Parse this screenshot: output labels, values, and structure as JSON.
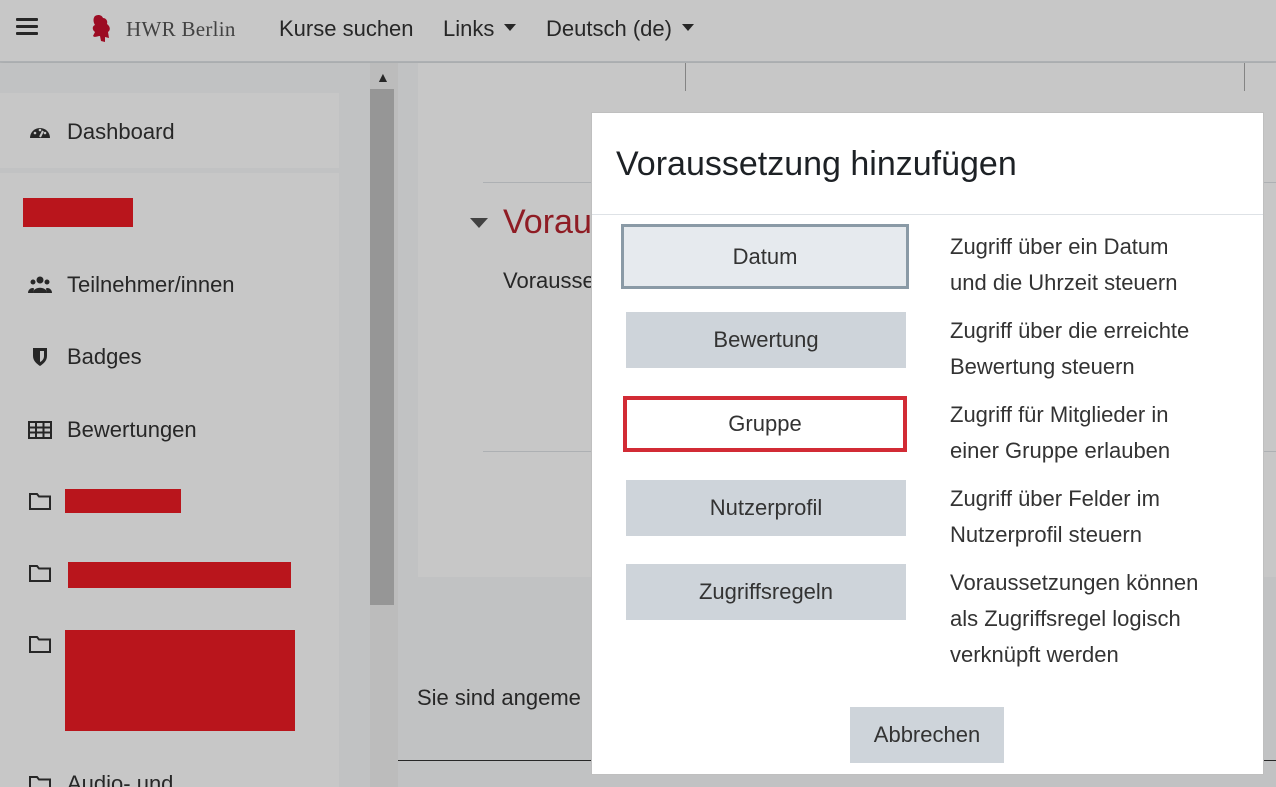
{
  "navbar": {
    "brand": "HWR Berlin",
    "links": [
      {
        "label": "Kurse suchen"
      },
      {
        "label": "Links"
      },
      {
        "label": "Deutsch (de)"
      }
    ]
  },
  "drawer": {
    "items": [
      {
        "label": "Dashboard",
        "icon": "dashboard-icon"
      },
      {
        "label": "Teilnehmer/innen",
        "icon": "users-icon"
      },
      {
        "label": "Badges",
        "icon": "shield-icon"
      },
      {
        "label": "Bewertungen",
        "icon": "table-icon"
      },
      {
        "label": "Audio- und",
        "icon": "folder-icon"
      }
    ]
  },
  "main": {
    "section_title": "Voraus",
    "section_subtitle": "Voraussetz",
    "footer_text": "Sie sind angeme"
  },
  "modal": {
    "title": "Voraussetzung hinzufügen",
    "options": [
      {
        "label": "Datum",
        "description_lines": [
          "Zugriff über ein Datum",
          "und die Uhrzeit steuern"
        ]
      },
      {
        "label": "Bewertung",
        "description_lines": [
          "Zugriff über die erreichte",
          "Bewertung steuern"
        ]
      },
      {
        "label": "Gruppe",
        "description_lines": [
          "Zugriff für Mitglieder in",
          "einer Gruppe erlauben"
        ]
      },
      {
        "label": "Nutzerprofil",
        "description_lines": [
          "Zugriff über Felder im",
          "Nutzerprofil steuern"
        ]
      },
      {
        "label": "Zugriffsregeln",
        "description_lines": [
          "Voraussetzungen können",
          "als Zugriffsregel logisch",
          "verknüpft werden"
        ]
      }
    ],
    "cancel_label": "Abbrechen"
  },
  "colors": {
    "accent_red": "#d22b35",
    "redaction": "#ed1c24",
    "section_title": "#b8252f"
  }
}
